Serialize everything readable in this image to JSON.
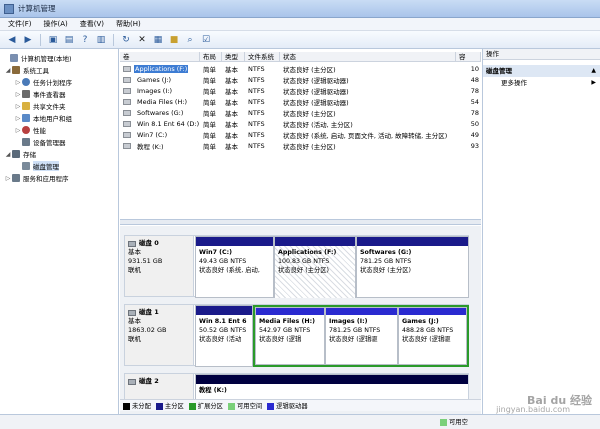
{
  "window": {
    "title": "计算机管理"
  },
  "menu": [
    "文件(F)",
    "操作(A)",
    "查看(V)",
    "帮助(H)"
  ],
  "tree": [
    {
      "label": "计算机管理(本地)",
      "indent": 0,
      "exp": "",
      "color": "#7a8fb0"
    },
    {
      "label": "系统工具",
      "indent": 1,
      "exp": "▲",
      "color": "#8a6a3a"
    },
    {
      "label": "任务计划程序",
      "indent": 2,
      "exp": "▷",
      "color": "#4a7ab8"
    },
    {
      "label": "事件查看器",
      "indent": 2,
      "exp": "▷",
      "color": "#6a6a6a"
    },
    {
      "label": "共享文件夹",
      "indent": 2,
      "exp": "▷",
      "color": "#d8b040"
    },
    {
      "label": "本地用户和组",
      "indent": 2,
      "exp": "▷",
      "color": "#5a8ac8"
    },
    {
      "label": "性能",
      "indent": 2,
      "exp": "▷",
      "color": "#b84040"
    },
    {
      "label": "设备管理器",
      "indent": 2,
      "exp": "",
      "color": "#6a7a8a"
    },
    {
      "label": "存储",
      "indent": 1,
      "exp": "▲",
      "color": "#5a6a7a"
    },
    {
      "label": "磁盘管理",
      "indent": 2,
      "exp": "",
      "color": "#7a8a9a",
      "selected": true
    },
    {
      "label": "服务和应用程序",
      "indent": 1,
      "exp": "▷",
      "color": "#6a7a8a"
    }
  ],
  "columns": [
    "卷",
    "布局",
    "类型",
    "文件系统",
    "状态",
    "容"
  ],
  "volumes": [
    {
      "name": "Applications (F:)",
      "layout": "简单",
      "type": "基本",
      "fs": "NTFS",
      "status": "状态良好 (主分区)",
      "cap": "10",
      "selected": true
    },
    {
      "name": "Games (J:)",
      "layout": "简单",
      "type": "基本",
      "fs": "NTFS",
      "status": "状态良好 (逻辑驱动器)",
      "cap": "48"
    },
    {
      "name": "Images (I:)",
      "layout": "简单",
      "type": "基本",
      "fs": "NTFS",
      "status": "状态良好 (逻辑驱动器)",
      "cap": "78"
    },
    {
      "name": "Media Files (H:)",
      "layout": "简单",
      "type": "基本",
      "fs": "NTFS",
      "status": "状态良好 (逻辑驱动器)",
      "cap": "54"
    },
    {
      "name": "Softwares (G:)",
      "layout": "简单",
      "type": "基本",
      "fs": "NTFS",
      "status": "状态良好 (主分区)",
      "cap": "78"
    },
    {
      "name": "Win 8.1 Ent 64 (D:)",
      "layout": "简单",
      "type": "基本",
      "fs": "NTFS",
      "status": "状态良好 (活动, 主分区)",
      "cap": "50"
    },
    {
      "name": "Win7 (C:)",
      "layout": "简单",
      "type": "基本",
      "fs": "NTFS",
      "status": "状态良好 (系统, 启动, 页面文件, 活动, 故障转储, 主分区)",
      "cap": "49"
    },
    {
      "name": "教程 (K:)",
      "layout": "简单",
      "type": "基本",
      "fs": "NTFS",
      "status": "状态良好 (主分区)",
      "cap": "93"
    }
  ],
  "disks": [
    {
      "name": "磁盘 0",
      "kind": "基本",
      "size": "931.51 GB",
      "state": "联机",
      "parts": [
        {
          "name": "Win7 (C:)",
          "size": "49.43 GB NTFS",
          "status": "状态良好 (系统, 启动,",
          "bar": "primary"
        },
        {
          "name": "Applications (F:)",
          "size": "100.83 GB NTFS",
          "status": "状态良好 (主分区)",
          "bar": "primary",
          "hatched": true
        },
        {
          "name": "Softwares (G:)",
          "size": "781.25 GB NTFS",
          "status": "状态良好 (主分区)",
          "bar": "primary"
        }
      ]
    },
    {
      "name": "磁盘 1",
      "kind": "基本",
      "size": "1863.02 GB",
      "state": "联机",
      "parts": [
        {
          "name": "Win 8.1 Ent 6",
          "size": "50.52 GB NTFS",
          "status": "状态良好 (活动",
          "bar": "primary"
        },
        {
          "name": "Media Files (H:)",
          "size": "542.97 GB NTFS",
          "status": "状态良好 (逻辑",
          "bar": "logical"
        },
        {
          "name": "Images (I:)",
          "size": "781.25 GB NTFS",
          "status": "状态良好 (逻辑驱",
          "bar": "logical"
        },
        {
          "name": "Games (J:)",
          "size": "488.28 GB NTFS",
          "status": "状态良好 (逻辑驱",
          "bar": "logical"
        }
      ]
    },
    {
      "name": "磁盘 2",
      "kind": "",
      "size": "",
      "state": "",
      "parts": [
        {
          "name": "教程 (K:)",
          "size": "",
          "status": "",
          "bar": "black"
        }
      ]
    }
  ],
  "legend": [
    {
      "label": "未分配",
      "color": "#000000"
    },
    {
      "label": "主分区",
      "color": "#1a1a8a"
    },
    {
      "label": "扩展分区",
      "color": "#2a9a2a"
    },
    {
      "label": "可用空间",
      "color": "#7ad07a"
    },
    {
      "label": "逻辑驱动器",
      "color": "#2a2ad0"
    },
    {
      "label": "可用空",
      "color": "#7ad07a"
    }
  ],
  "actions": {
    "header": "操作",
    "section": "磁盘管理",
    "more": "更多操作"
  },
  "watermark": {
    "brand": "Bai du 经验",
    "url": "jingyan.baidu.com"
  }
}
